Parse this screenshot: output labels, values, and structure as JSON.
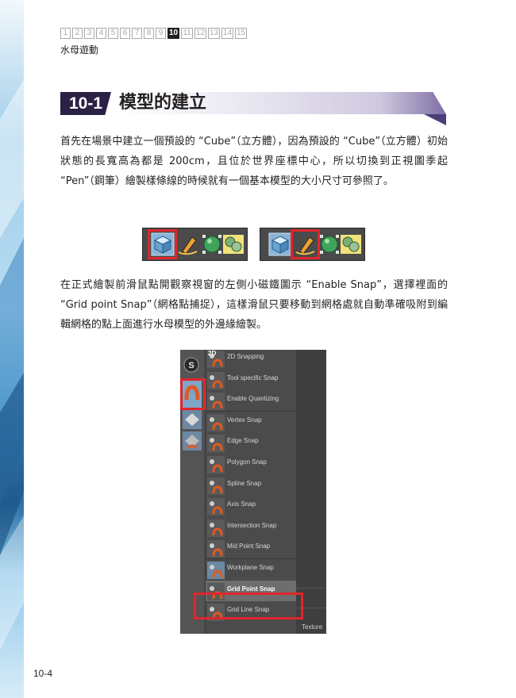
{
  "chapter_nav": {
    "numbers": [
      "1",
      "2",
      "3",
      "4",
      "5",
      "6",
      "7",
      "8",
      "9",
      "10",
      "11",
      "12",
      "13",
      "14",
      "15"
    ],
    "active": "10"
  },
  "chapter_title": "水母遊動",
  "section": {
    "number": "10-1",
    "title": "模型的建立"
  },
  "paragraphs": [
    "首先在場景中建立一個預設的 “Cube”（立方體），因為預設的 “Cube”（立方體）初始狀態的長寬高為都是 200cm，且位於世界座標中心，所以切換到正視圖季起 “Pen”（鋼筆）繪製樣條線的時候就有一個基本模型的大小尺寸可參照了。",
    "在正式繪製前滑鼠點開觀察視窗的左側小磁鐵圖示 “Enable Snap”，選擇裡面的 “Grid point Snap”（網格點捕捉），這樣滑鼠只要移動到網格處就自動準確吸附到編輯網格的點上面進行水母模型的外邊緣繪製。"
  ],
  "toolbar_icons": [
    "cube-icon",
    "pen-icon",
    "sphere-icon",
    "spline-icon"
  ],
  "snap_menu": {
    "items": [
      "2D Snapping",
      "Tool specific Snap",
      "Enable Quantizing",
      "Vertex Snap",
      "Edge Snap",
      "Polygon Snap",
      "Spline Snap",
      "Axis Snap",
      "Intersection Snap",
      "Mid Point Snap",
      "Workplane Snap",
      "Grid Point Snap",
      "Grid Line Snap"
    ],
    "selected": "Grid Point Snap",
    "side_label": "Texture",
    "side_badge": "2D",
    "strip_letter": "S"
  },
  "colors": {
    "highlight": "#e0262d",
    "section_badge": "#2b2144",
    "ui_dark": "#4b4b4b"
  },
  "page_number": "10-4"
}
